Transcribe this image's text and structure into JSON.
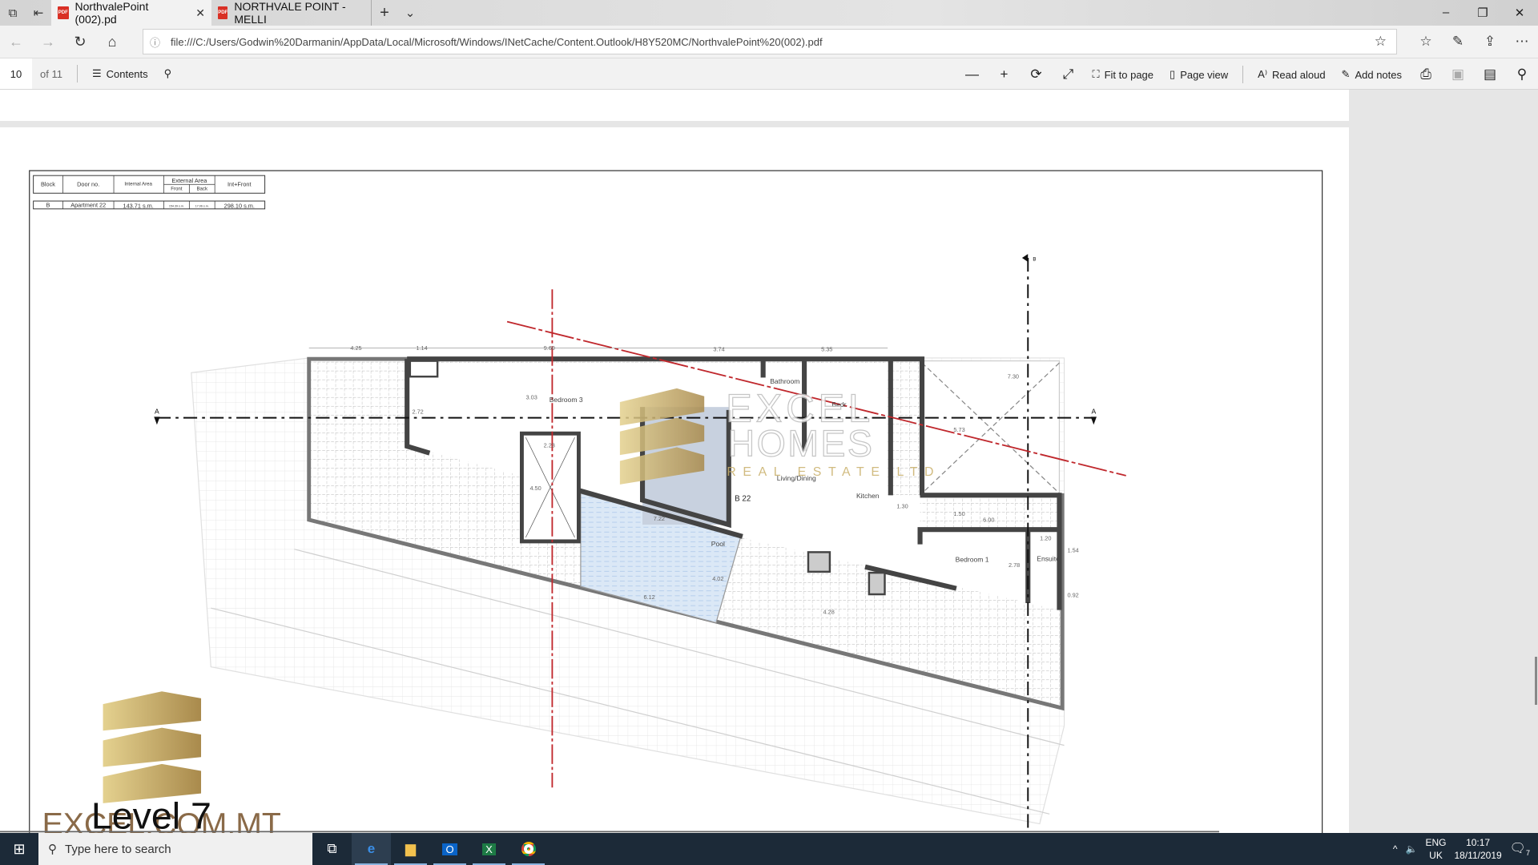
{
  "browser": {
    "tabs": [
      {
        "title": "NorthvalePoint (002).pd",
        "icon": "pdf-icon",
        "active": true
      },
      {
        "title": "NORTHVALE POINT - MELLI",
        "icon": "pdf-icon",
        "active": false
      }
    ],
    "url": "file:///C:/Users/Godwin%20Darmanin/AppData/Local/Microsoft/Windows/INetCache/Content.Outlook/H8Y520MC/NorthvalePoint%20(002).pdf"
  },
  "pdf_toolbar": {
    "page_current": "10",
    "page_total": "of 11",
    "contents_label": "Contents",
    "fit_to_page": "Fit to page",
    "page_view": "Page view",
    "read_aloud": "Read aloud",
    "add_notes": "Add notes"
  },
  "schedule": {
    "headers": {
      "block": "Block",
      "door": "Door no.",
      "internal": "Internal Area",
      "external": "External Area",
      "front": "Front",
      "back": "Back",
      "int_front": "Int+Front"
    },
    "row": {
      "block": "B",
      "door": "Apartment 22",
      "internal": "143.71 s.m.",
      "front": "154.39 s.m.",
      "back": "17.06 s.m.",
      "int_front": "298.10 s.m."
    }
  },
  "plan": {
    "section_marker": "A",
    "section_marker_top": "B",
    "unit_label": "B 22",
    "rooms": {
      "bedroom3": "Bedroom 3",
      "bathroom": "Bathroom",
      "bedroom2": "Bedr",
      "living": "Living/Dining",
      "kitchen": "Kitchen",
      "pool": "Pool",
      "bedroom1": "Bedroom 1",
      "ensuite": "Ensuite"
    },
    "dimensions": [
      "4.25",
      "1.14",
      "9.60",
      "3.74",
      "5.35",
      "7.30",
      "2.72",
      "3.03",
      "2.23",
      "4.50",
      "7.22",
      "5.73",
      "1.30",
      "1.50",
      "6.00",
      "1.20",
      "1.54",
      "2.78",
      "0.92",
      "4.28",
      "6.12",
      "4.02"
    ],
    "level_label": "Level 7"
  },
  "watermark": {
    "line1": "EXCEL",
    "line2": "HOMES",
    "line3": "REAL ESTATE LTD"
  },
  "logo": {
    "text": "EXCEL.COM.MT",
    "gold": "#c9b06a",
    "brown": "#8a6a48"
  },
  "colors": {
    "wall": "#4a4a4a",
    "section_red": "#c0282d",
    "pool": "#dbe8f6",
    "core": "#c8d1df"
  },
  "taskbar": {
    "search_placeholder": "Type here to search",
    "apps": [
      "task-view",
      "edge",
      "file-explorer",
      "outlook",
      "excel",
      "chrome"
    ],
    "lang": "ENG",
    "region": "UK",
    "time": "10:17",
    "date": "18/11/2019",
    "notifications": "7"
  }
}
